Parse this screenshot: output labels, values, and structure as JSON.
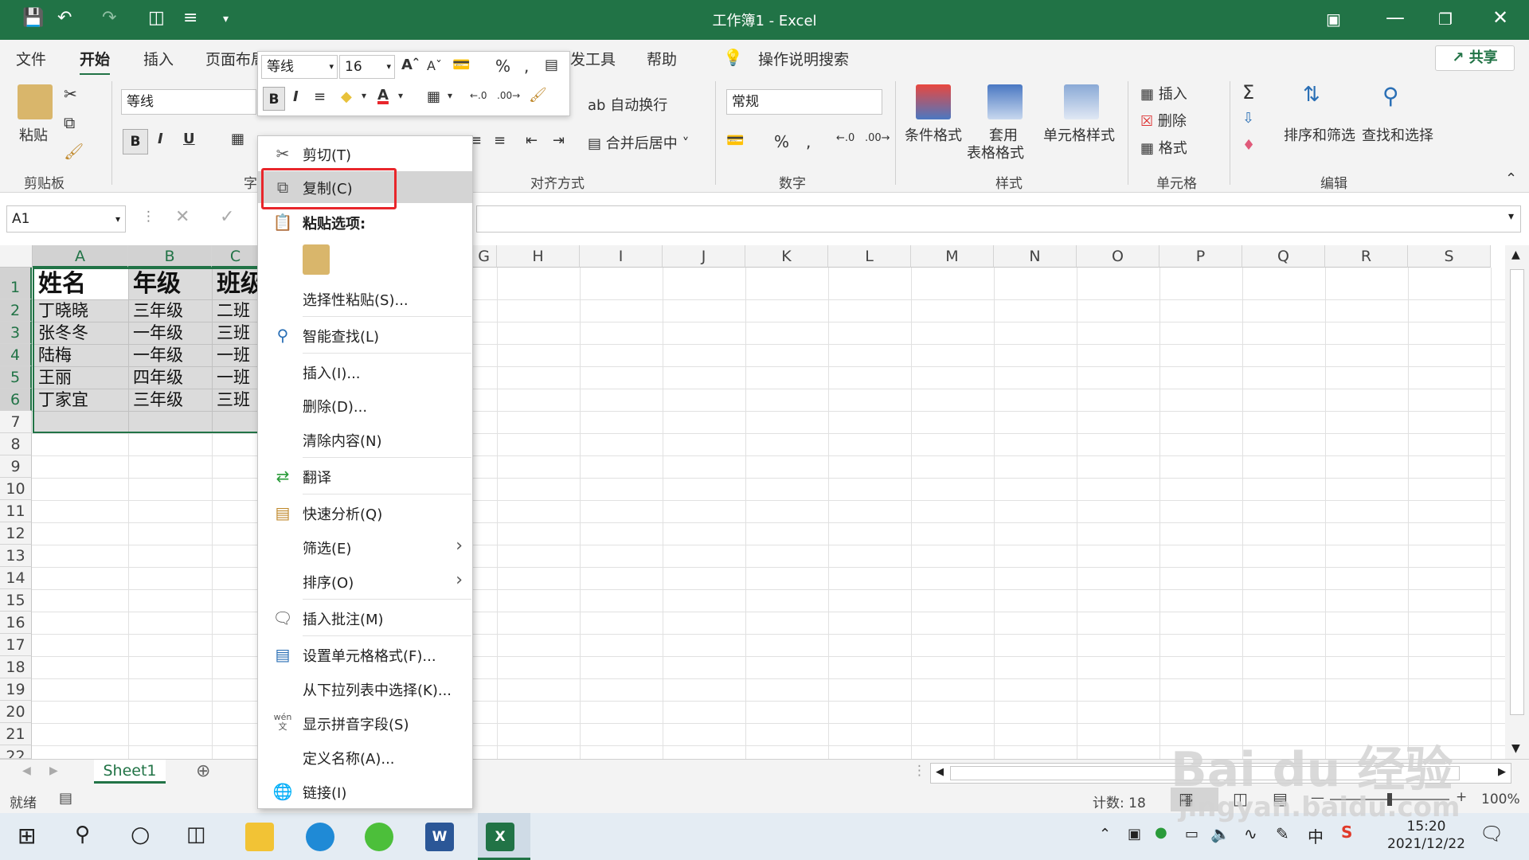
{
  "window": {
    "title": "工作簿1  -  Excel"
  },
  "tabs": [
    "文件",
    "开始",
    "插入",
    "页面布局",
    "发工具",
    "帮助",
    "操作说明搜索"
  ],
  "share_label": "共享",
  "ribbon": {
    "paste": "粘贴",
    "clipboard": "剪贴板",
    "font_name": "等线",
    "font_group": "字",
    "align_group": "对齐方式",
    "wrap": "自动换行",
    "merge": "合并后居中",
    "number_format": "常规",
    "number_group": "数字",
    "cond_format": "条件格式",
    "table_format_1": "套用",
    "table_format_2": "表格格式",
    "cell_style": "单元格样式",
    "styles_group": "样式",
    "insert": "插入",
    "delete": "删除",
    "format": "格式",
    "cells_group": "单元格",
    "sort_filter": "排序和筛选",
    "find_select": "查找和选择",
    "edit_group": "编辑"
  },
  "minibar": {
    "font": "等线",
    "size": "16"
  },
  "namebox": "A1",
  "columns": [
    "A",
    "B",
    "C",
    "G",
    "H",
    "I",
    "J",
    "K",
    "L",
    "M",
    "N",
    "O",
    "P",
    "Q",
    "R",
    "S"
  ],
  "rows": [
    "1",
    "2",
    "3",
    "4",
    "5",
    "6",
    "7",
    "8",
    "9",
    "10",
    "11",
    "12",
    "13",
    "14",
    "15",
    "16",
    "17",
    "18",
    "19",
    "20",
    "21",
    "22"
  ],
  "cells": [
    [
      "姓名",
      "年级",
      "班级"
    ],
    [
      "丁晓晓",
      "三年级",
      "二班"
    ],
    [
      "张冬冬",
      "一年级",
      "三班"
    ],
    [
      "陆梅",
      "一年级",
      "一班"
    ],
    [
      "王丽",
      "四年级",
      "一班"
    ],
    [
      "丁家宜",
      "三年级",
      "三班"
    ]
  ],
  "context_menu": {
    "cut": "剪切(T)",
    "copy": "复制(C)",
    "paste_options": "粘贴选项:",
    "paste_special": "选择性粘贴(S)...",
    "smart_lookup": "智能查找(L)",
    "insert": "插入(I)...",
    "delete": "删除(D)...",
    "clear": "清除内容(N)",
    "translate": "翻译",
    "quick_analysis": "快速分析(Q)",
    "filter": "筛选(E)",
    "sort": "排序(O)",
    "insert_comment": "插入批注(M)",
    "format_cells": "设置单元格格式(F)...",
    "pick_list": "从下拉列表中选择(K)...",
    "phonetic": "显示拼音字段(S)",
    "define_name": "定义名称(A)...",
    "link": "链接(I)"
  },
  "sheet_tab": "Sheet1",
  "status": {
    "ready": "就绪",
    "count": "计数: 18",
    "zoom": "100%"
  },
  "clock": {
    "time": "15:20",
    "date": "2021/12/22"
  },
  "ime": "中",
  "phonetic_icon_text": "wén",
  "watermark": {
    "brand": "Bai du 经验",
    "url": "jingyan.baidu.com"
  },
  "colors": {
    "excel_green": "#217346",
    "highlight_red": "#e8262b"
  }
}
